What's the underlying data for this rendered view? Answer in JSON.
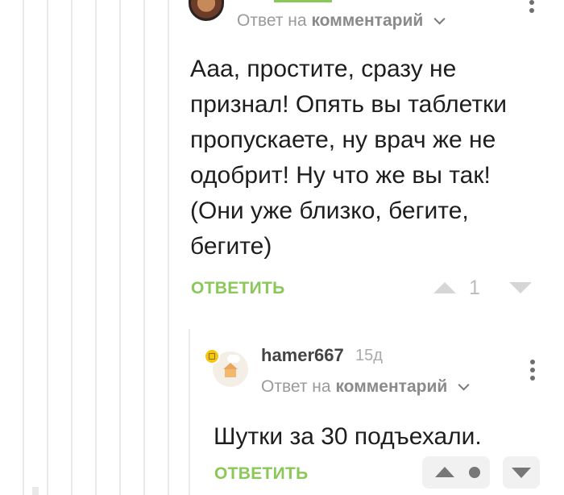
{
  "parent_comment": {
    "reply_prefix": "Ответ на",
    "reply_target": "комментарий",
    "body": "Ааа, простите, сразу не признал! Опять вы таблетки пропускаете, ну врач же не одобрит! Ну что же вы так! (Они уже близко, бегите, бегите)",
    "reply_button": "ОТВЕТИТЬ",
    "rating": "1"
  },
  "child_comment": {
    "username": "hamer667",
    "time_ago": "15д",
    "reply_prefix": "Ответ на",
    "reply_target": "комментарий",
    "body": "Шутки за 30 подъехали.",
    "reply_button": "ОТВЕТИТЬ"
  },
  "icons": {
    "more": "more-vertical-icon",
    "chevron": "chevron-down-icon",
    "upvote": "upvote-icon",
    "downvote": "downvote-icon"
  },
  "colors": {
    "accent_green": "#8ac858",
    "meta_gray": "#9a9a9a",
    "thread_line": "#e9e9e9"
  }
}
